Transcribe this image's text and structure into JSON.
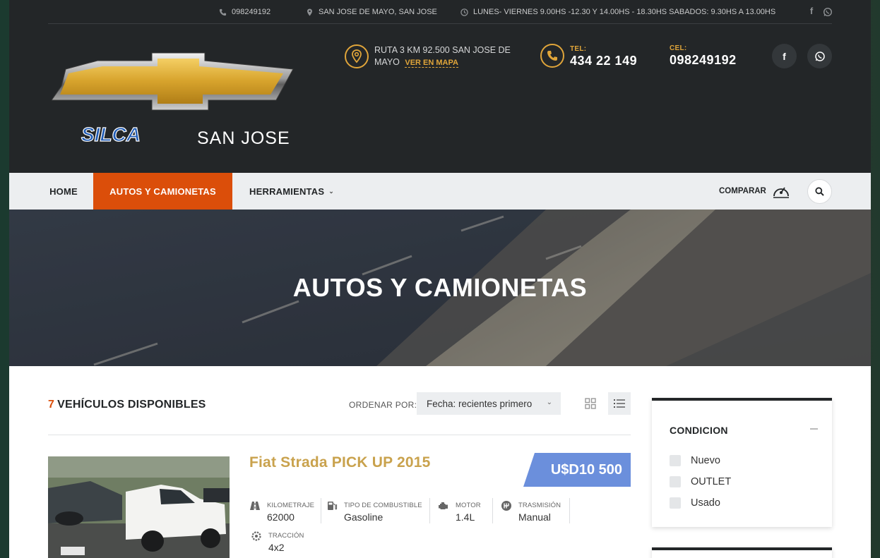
{
  "topbar": {
    "phone": "098249192",
    "location": "SAN JOSE DE MAYO, SAN JOSE",
    "hours": "LUNES- VIERNES 9.00HS -12.30 Y 14.00HS - 18.30HS SABADOS: 9.30HS A 13.00HS",
    "icons": [
      "phone-icon",
      "map-pin-icon",
      "clock-icon",
      "facebook-icon",
      "whatsapp-icon"
    ]
  },
  "logo": {
    "brand": "SILCA",
    "location": "SAN JOSE"
  },
  "contact": {
    "address": "RUTA 3 KM 92.500 SAN JOSE DE MAYO",
    "map_link": "VER EN MAPA",
    "tel_label": "TEL:",
    "tel": "434 22 149",
    "cel_label": "CEL:",
    "cel": "098249192"
  },
  "nav": {
    "items": [
      {
        "label": "HOME"
      },
      {
        "label": "AUTOS Y CAMIONETAS",
        "active": true
      },
      {
        "label": "HERRAMIENTAS"
      }
    ],
    "compare_label": "COMPARAR"
  },
  "hero": {
    "title": "AUTOS Y CAMIONETAS"
  },
  "listing": {
    "count": "7",
    "count_label": "VEHÍCULOS DISPONIBLES",
    "sort_label": "ORDENAR POR:",
    "sort_value": "Fecha: recientes primero",
    "view_mode": "list"
  },
  "car": {
    "title": "Fiat Strada PICK UP 2015",
    "price": "U$D10 500",
    "specs": [
      {
        "label": "KILOMETRAJE",
        "value": "62000",
        "icon": "road-icon"
      },
      {
        "label": "TIPO DE COMBUSTIBLE",
        "value": "Gasoline",
        "icon": "fuel-icon"
      },
      {
        "label": "MOTOR",
        "value": "1.4L",
        "icon": "engine-icon"
      },
      {
        "label": "TRASMISIÓN",
        "value": "Manual",
        "icon": "gearbox-icon"
      },
      {
        "label": "TRACCIÓN",
        "value": "4x2",
        "icon": "drivetrain-icon"
      }
    ]
  },
  "sidebar": {
    "condition_title": "CONDICION",
    "options": [
      {
        "label": "Nuevo",
        "checked": false
      },
      {
        "label": "OUTLET",
        "checked": false
      },
      {
        "label": "Usado",
        "checked": false
      }
    ]
  },
  "colors": {
    "accent": "#db4e0a",
    "gold": "#e0a53a",
    "title_gold": "#c9a24d",
    "price_blue": "#6b8fdc",
    "header_dark": "#232628"
  }
}
